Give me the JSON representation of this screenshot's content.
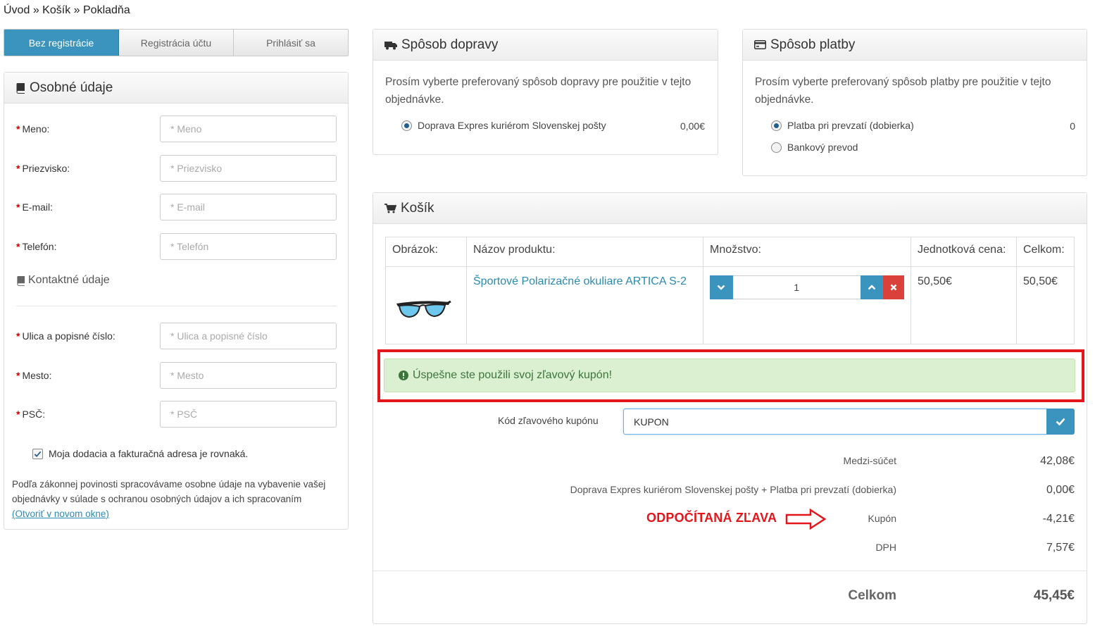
{
  "breadcrumb": {
    "home": "Úvod",
    "cart": "Košík",
    "checkout": "Pokladňa",
    "sep": "»"
  },
  "tabs": [
    {
      "label": "Bez registrácie",
      "active": true
    },
    {
      "label": "Registrácia účtu",
      "active": false
    },
    {
      "label": "Prihlásiť sa",
      "active": false
    }
  ],
  "personal": {
    "title": "Osobné údaje",
    "fields": [
      {
        "label": "Meno:",
        "placeholder": "* Meno"
      },
      {
        "label": "Priezvisko:",
        "placeholder": "* Priezvisko"
      },
      {
        "label": "E-mail:",
        "placeholder": "* E-mail"
      },
      {
        "label": "Telefón:",
        "placeholder": "* Telefón"
      }
    ],
    "contact_title": "Kontaktné údaje",
    "address_fields": [
      {
        "label": "Ulica a popisné číslo:",
        "placeholder": "* Ulica a popisné číslo"
      },
      {
        "label": "Mesto:",
        "placeholder": "* Mesto"
      },
      {
        "label": "PSČ:",
        "placeholder": "* PSČ"
      }
    ],
    "same_address": "Moja dodacia a fakturačná adresa je rovnaká.",
    "gdpr_text": "Podľa zákonnej povinosti spracovávame osobne údaje na vybavenie vašej objednávky v súlade s ochranou osobných údajov a ich spracovaním",
    "gdpr_link": "(Otvoriť v novom okne)"
  },
  "shipping": {
    "title": "Spôsob dopravy",
    "text": "Prosím vyberte preferovaný spôsob dopravy pre použitie v tejto objednávke.",
    "options": [
      {
        "label": "Doprava Expres kuriérom Slovenskej pošty",
        "price": "0,00€",
        "selected": true
      }
    ]
  },
  "payment": {
    "title": "Spôsob platby",
    "text": "Prosím vyberte preferovaný spôsob platby pre použitie v tejto objednávke.",
    "options": [
      {
        "label": "Platba pri prevzatí (dobierka)",
        "price": "0",
        "selected": true
      },
      {
        "label": "Bankový prevod",
        "price": "",
        "selected": false
      }
    ]
  },
  "cart": {
    "title": "Košík",
    "columns": [
      "Obrázok:",
      "Názov produktu:",
      "Množstvo:",
      "Jednotková cena:",
      "Celkom:"
    ],
    "items": [
      {
        "name": "Športové Polarizačné okuliare ARTICA S-2",
        "qty": "1",
        "unit_price": "50,50€",
        "total": "50,50€"
      }
    ],
    "success": "Úspešne ste použili svoj zľavový kupón!",
    "coupon_label": "Kód zľavového kupónu",
    "coupon_value": "KUPON",
    "summary": [
      {
        "label": "Medzi-súčet",
        "value": "42,08€"
      },
      {
        "label": "Doprava Expres kuriérom Slovenskej pošty + Platba pri prevzatí (dobierka)",
        "value": "0,00€"
      },
      {
        "label": "Kupón",
        "value": "-4,21€"
      },
      {
        "label": "DPH",
        "value": "7,57€"
      }
    ],
    "discount_note": "ODPOČÍTANÁ ZĽAVA",
    "total_label": "Celkom",
    "total_value": "45,45€"
  },
  "colors": {
    "accent": "#3b94bd",
    "danger": "#d9413a",
    "highlight": "#e3161b",
    "success_bg": "#dbf0d0"
  }
}
